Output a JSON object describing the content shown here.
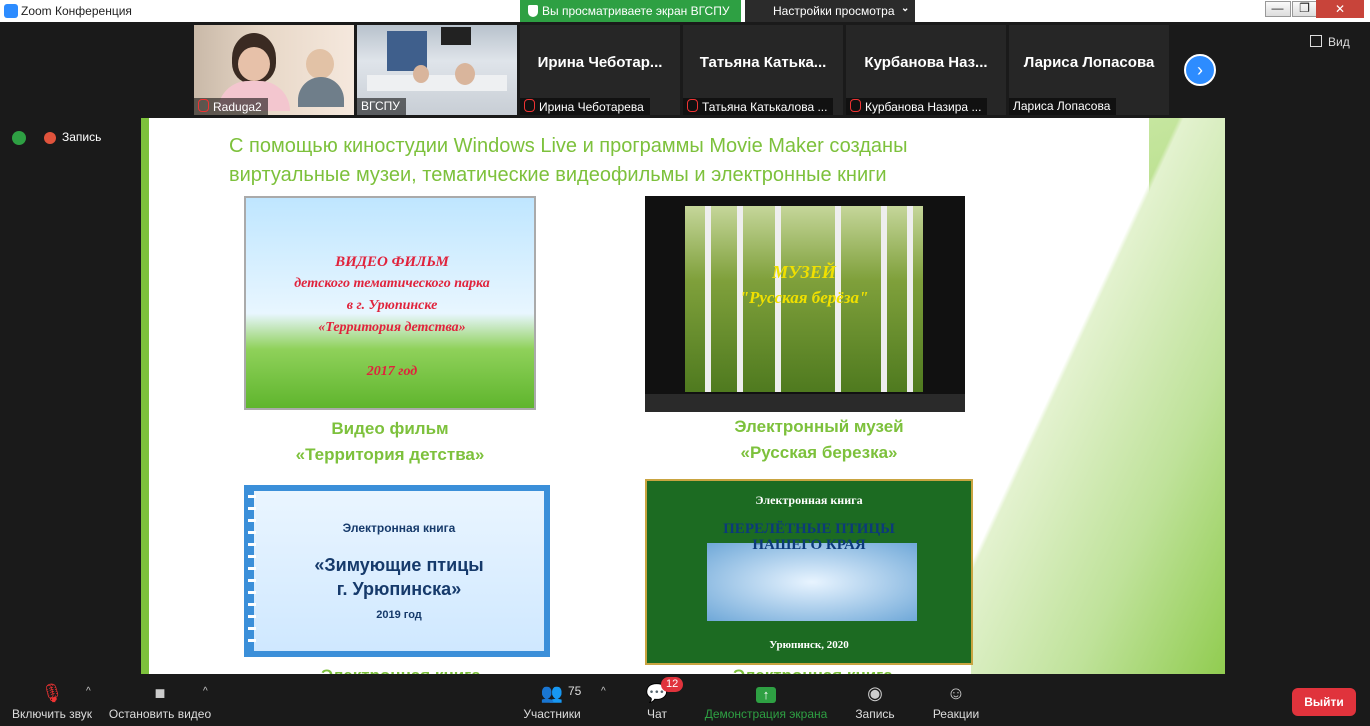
{
  "titlebar": {
    "title": "Zoom Конференция",
    "share_notice": "Вы просматриваете экран ВГСПУ",
    "view_options": "Настройки просмотра",
    "close": "✕",
    "minimize": "—",
    "maximize": "❐",
    "restore": "⧉"
  },
  "strip": {
    "tiles": [
      {
        "name": "Raduga2",
        "muted": true
      },
      {
        "name": "ВГСПУ",
        "muted": false
      },
      {
        "name": "Ирина Чеботарева",
        "big": "Ирина  Чеботар...",
        "muted": true
      },
      {
        "name": "Татьяна Катькалова ...",
        "big": "Татьяна  Катька...",
        "muted": true
      },
      {
        "name": "Курбанова Назира ...",
        "big": "Курбанова  Наз...",
        "muted": true
      },
      {
        "name": "Лариса Лопасова",
        "big": "Лариса Лопасова",
        "muted": false
      }
    ],
    "view_label": "Вид",
    "next_arrow": "›"
  },
  "recording": {
    "label": "Запись"
  },
  "slide": {
    "title_line1": "С помощью киностудии Windows Live и программы Movie Maker созданы",
    "title_line2": "виртуальные музеи, тематические видеофильмы и электронные книги",
    "items": [
      {
        "caption1": "Видео фильм",
        "caption2": "«Территория детства»",
        "pic_lines": [
          "ВИДЕО ФИЛЬМ",
          "детского тематического парка",
          "в г. Урюпинске",
          "«Территория детства»",
          "2017 год"
        ]
      },
      {
        "caption1": "Электронный музей",
        "caption2": "«Русская березка»",
        "pic_lines": [
          "МУЗЕЙ",
          "\"Русская берёза\""
        ]
      },
      {
        "caption_cut": "Электронная книга",
        "pic_lines": [
          "Электронная книга",
          "«Зимующие птицы",
          "г. Урюпинска»",
          "2019 год"
        ]
      },
      {
        "caption_cut": "Электронная книга",
        "pic_lines": [
          "Электронная книга",
          "ПЕРЕЛЁТНЫЕ ПТИЦЫ",
          "НАШЕГО КРАЯ",
          "Урюпинск, 2020"
        ]
      }
    ]
  },
  "toolbar": {
    "mute_label": "Включить звук",
    "video_label": "Остановить видео",
    "participants_label": "Участники",
    "participants_count": "75",
    "chat_label": "Чат",
    "chat_badge": "12",
    "share_label": "Демонстрация экрана",
    "record_label": "Запись",
    "reactions_label": "Реакции",
    "leave_label": "Выйти",
    "caret": "^"
  },
  "colors": {
    "accent": "#2d8cff",
    "share_green": "#2ea043",
    "slide_green": "#7dc13c",
    "leave_red": "#e0333c"
  }
}
